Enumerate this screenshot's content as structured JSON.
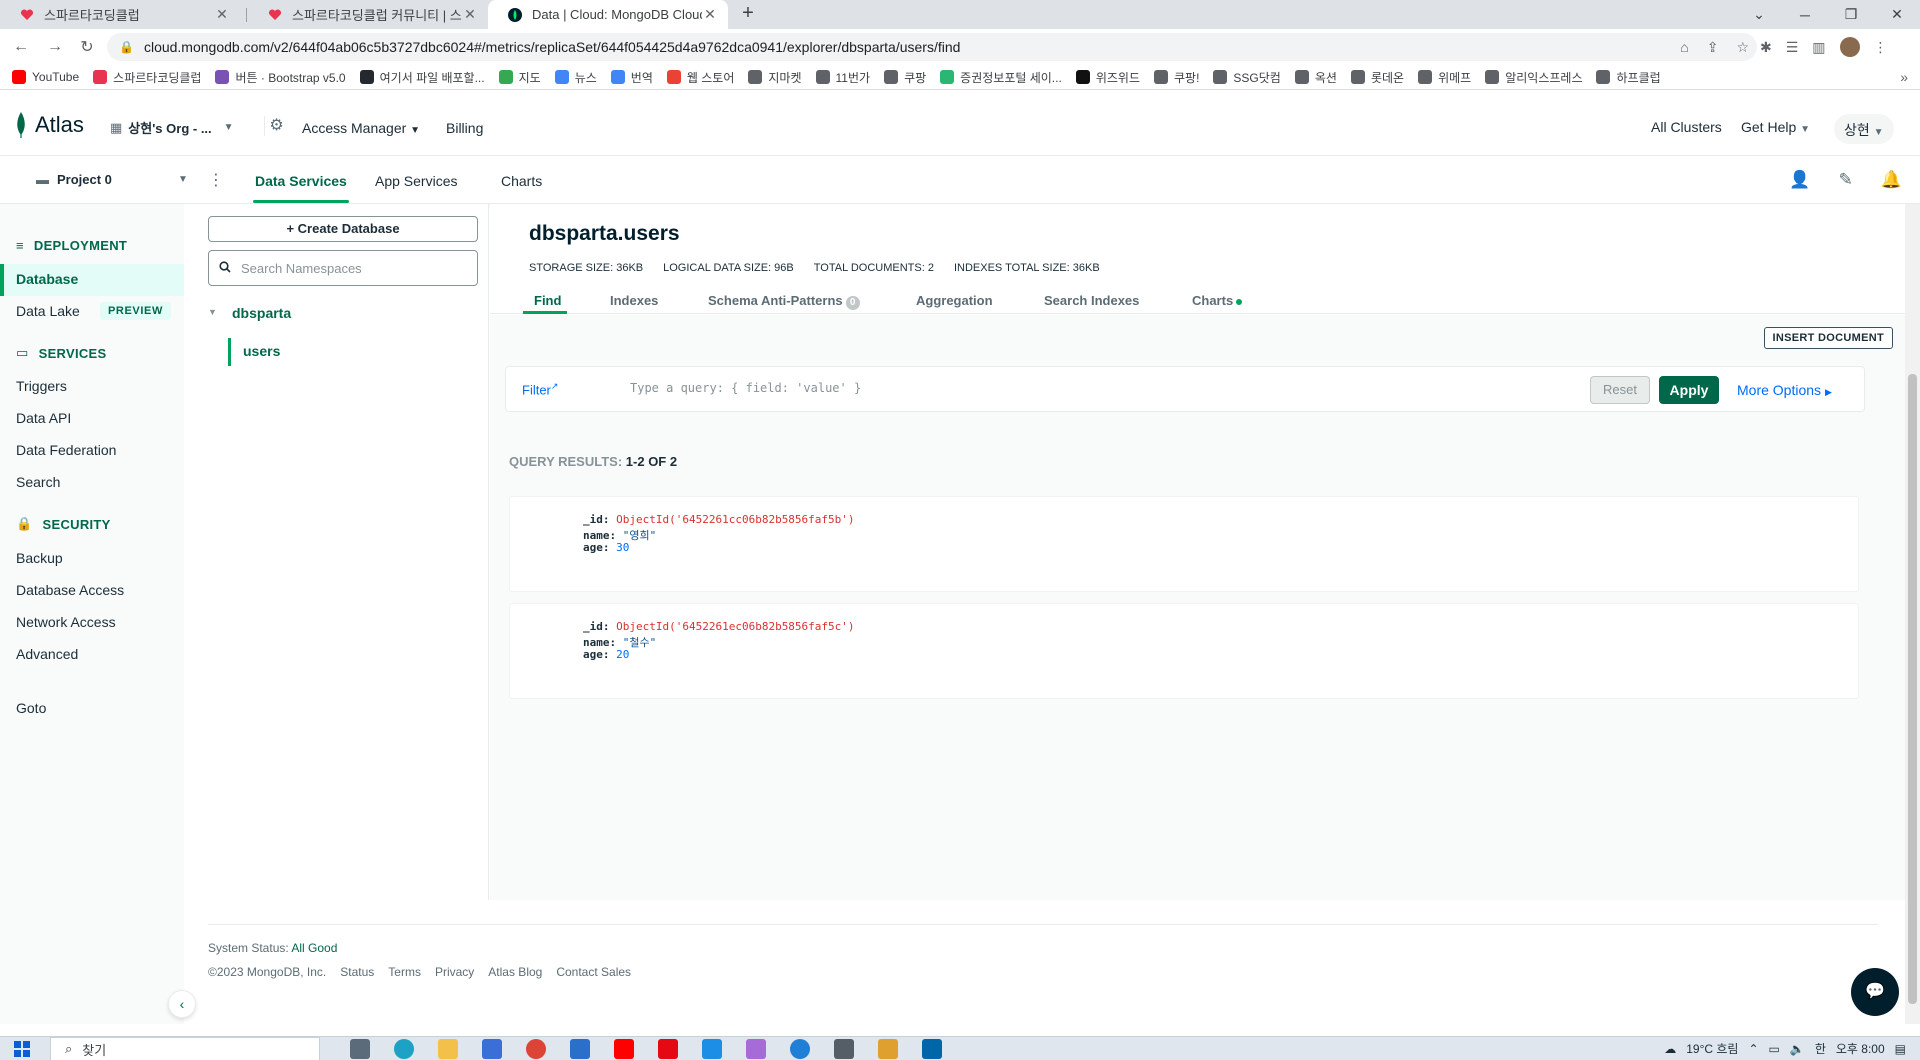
{
  "browser": {
    "tabs": [
      {
        "title": "스파르타코딩클럽",
        "active": false
      },
      {
        "title": "스파르타코딩클럽 커뮤니티 | 스",
        "active": false
      },
      {
        "title": "Data | Cloud: MongoDB Cloud",
        "active": true
      }
    ],
    "url": "cloud.mongodb.com/v2/644f04ab06c5b3727dbc6024#/metrics/replicaSet/644f054425d4a9762dca0941/explorer/dbsparta/users/find",
    "bookmarks": [
      {
        "label": "YouTube",
        "color": "#ff0000"
      },
      {
        "label": "스파르타코딩클럽",
        "color": "#e8344e"
      },
      {
        "label": "버튼 · Bootstrap v5.0",
        "color": "#7952b3"
      },
      {
        "label": "여기서 파일 배포할...",
        "color": "#24292f"
      },
      {
        "label": "지도",
        "color": "#34a853"
      },
      {
        "label": "뉴스",
        "color": "#4285f4"
      },
      {
        "label": "번역",
        "color": "#4285f4"
      },
      {
        "label": "웹 스토어",
        "color": "#ea4335"
      },
      {
        "label": "지마켓",
        "color": "#5f6368"
      },
      {
        "label": "11번가",
        "color": "#5f6368"
      },
      {
        "label": "쿠팡",
        "color": "#5f6368"
      },
      {
        "label": "증권정보포털 세이...",
        "color": "#2bb673"
      },
      {
        "label": "위즈위드",
        "color": "#111111"
      },
      {
        "label": "쿠팡!",
        "color": "#5f6368"
      },
      {
        "label": "SSG닷컴",
        "color": "#5f6368"
      },
      {
        "label": "옥션",
        "color": "#5f6368"
      },
      {
        "label": "롯데온",
        "color": "#5f6368"
      },
      {
        "label": "위메프",
        "color": "#5f6368"
      },
      {
        "label": "알리익스프레스",
        "color": "#5f6368"
      },
      {
        "label": "하프클럽",
        "color": "#5f6368"
      }
    ]
  },
  "atlas": {
    "logo_text": "Atlas",
    "org_name": "상현's Org - ...",
    "access_manager": "Access Manager",
    "billing": "Billing",
    "all_clusters": "All Clusters",
    "get_help": "Get Help",
    "user": "상현",
    "project": "Project 0",
    "subtabs": [
      "Data Services",
      "App Services",
      "Charts"
    ]
  },
  "leftnav": {
    "deployment": "DEPLOYMENT",
    "database": "Database",
    "data_lake": "Data Lake",
    "preview": "PREVIEW",
    "services": "SERVICES",
    "triggers": "Triggers",
    "data_api": "Data API",
    "data_federation": "Data Federation",
    "search": "Search",
    "security": "SECURITY",
    "backup": "Backup",
    "database_access": "Database Access",
    "network_access": "Network Access",
    "advanced": "Advanced",
    "goto": "Goto"
  },
  "dbpanel": {
    "create_db": "Create Database",
    "search_placeholder": "Search Namespaces",
    "db_name": "dbsparta",
    "collection": "users"
  },
  "collection": {
    "title": "dbsparta.users",
    "stats": {
      "storage": "STORAGE SIZE: 36KB",
      "logical": "LOGICAL DATA SIZE: 96B",
      "total_docs": "TOTAL DOCUMENTS: 2",
      "indexes": "INDEXES TOTAL SIZE: 36KB"
    },
    "tabs": {
      "find": "Find",
      "indexes": "Indexes",
      "anti_patterns": "Schema Anti-Patterns",
      "anti_patterns_count": "0",
      "aggregation": "Aggregation",
      "search_indexes": "Search Indexes",
      "charts": "Charts"
    },
    "insert_document": "INSERT DOCUMENT",
    "filter_label": "Filter",
    "query_placeholder": "Type a query: { field: 'value' }",
    "reset": "Reset",
    "apply": "Apply",
    "more_options": "More Options",
    "results_prefix": "QUERY RESULTS:",
    "results_range": "1-2 OF 2",
    "documents": [
      {
        "_id": "ObjectId('6452261cc06b82b5856faf5b')",
        "name": "\"영희\"",
        "age": "30"
      },
      {
        "_id": "ObjectId('6452261ec06b82b5856faf5c')",
        "name": "\"철수\"",
        "age": "20"
      }
    ]
  },
  "footer": {
    "status_label": "System Status:",
    "status_value": "All Good",
    "links": [
      "©2023 MongoDB, Inc.",
      "Status",
      "Terms",
      "Privacy",
      "Atlas Blog",
      "Contact Sales"
    ]
  },
  "taskbar": {
    "search": "찾기",
    "weather": "19°C 흐림",
    "ime": "한",
    "time": "오후 8:00"
  }
}
